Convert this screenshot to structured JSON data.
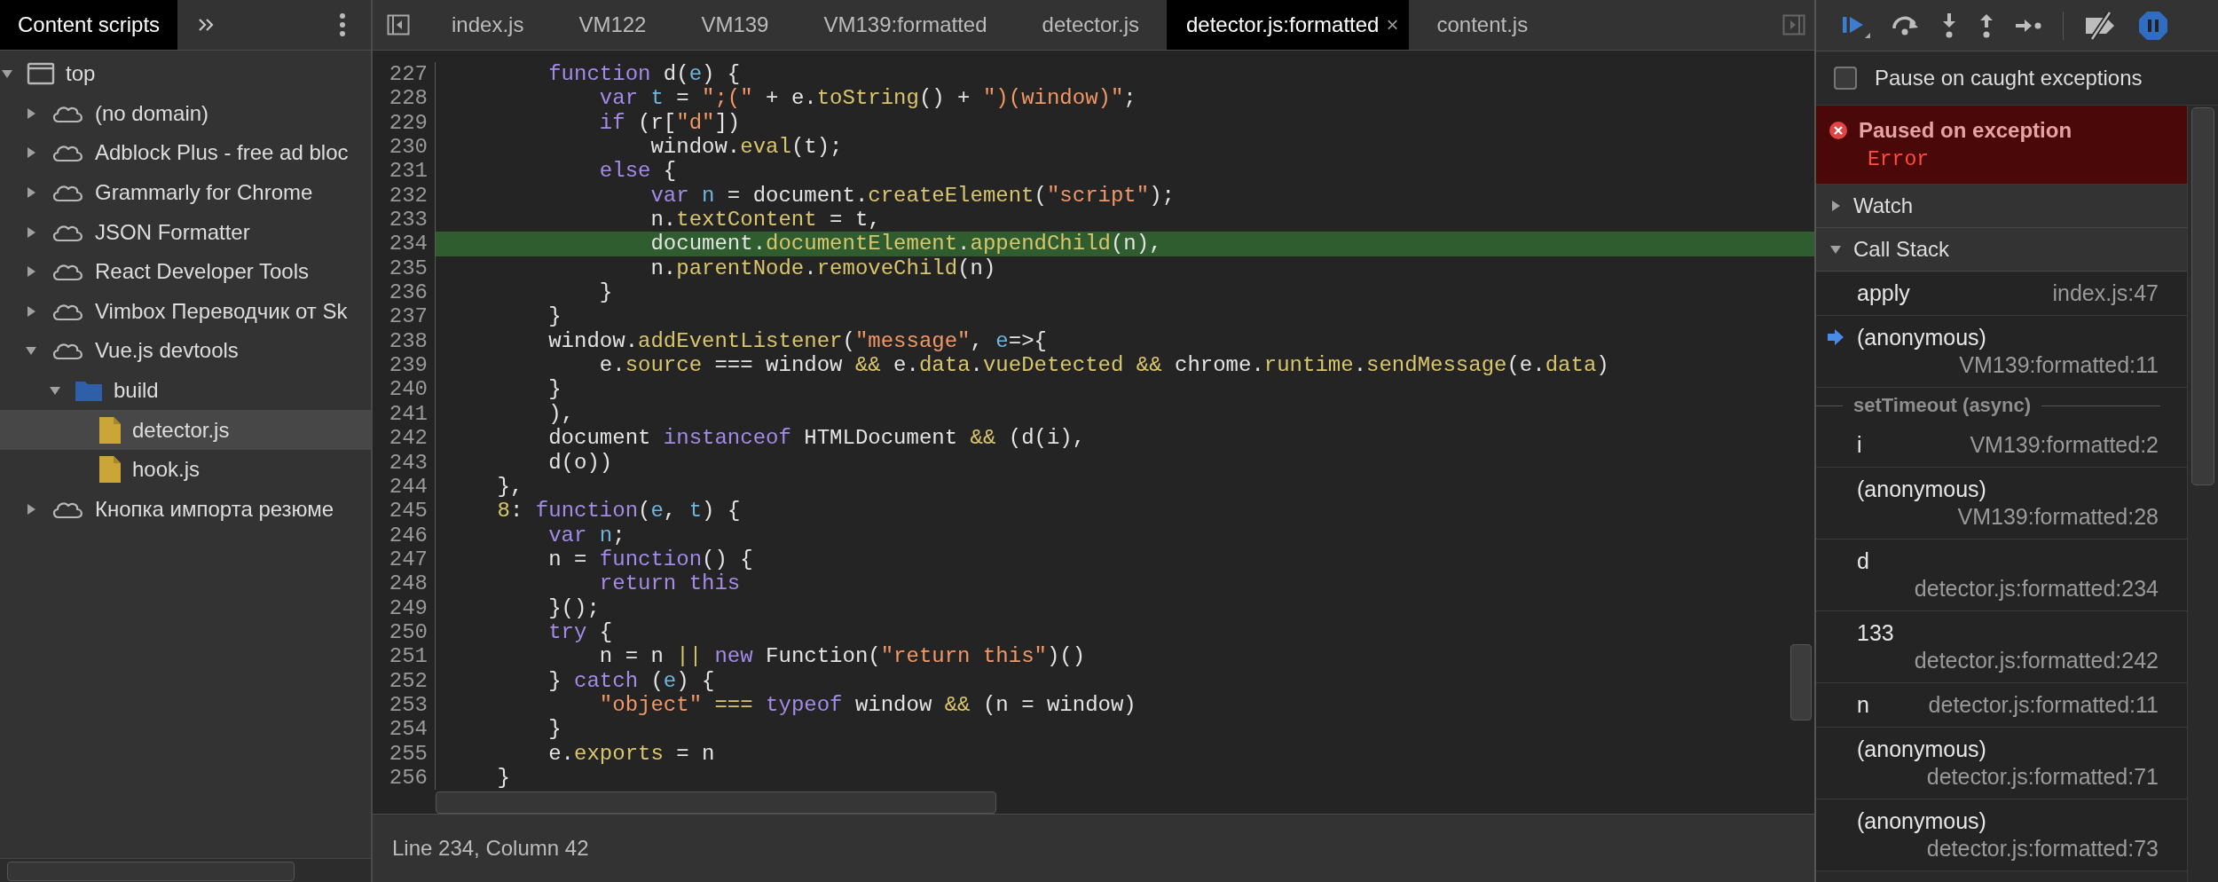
{
  "sidebar": {
    "tabs": [
      {
        "label": "Content scripts",
        "selected": true
      }
    ],
    "tree": [
      {
        "label": "top",
        "kind": "frame",
        "expanded": true,
        "selected": false,
        "children": [
          {
            "label": "(no domain)",
            "kind": "domain",
            "expanded": false,
            "selected": false
          },
          {
            "label": "Adblock Plus - free ad bloc",
            "kind": "domain",
            "expanded": false,
            "selected": false
          },
          {
            "label": "Grammarly for Chrome",
            "kind": "domain",
            "expanded": false,
            "selected": false
          },
          {
            "label": "JSON Formatter",
            "kind": "domain",
            "expanded": false,
            "selected": false
          },
          {
            "label": "React Developer Tools",
            "kind": "domain",
            "expanded": false,
            "selected": false
          },
          {
            "label": "Vimbox Переводчик от Sk",
            "kind": "domain",
            "expanded": false,
            "selected": false
          },
          {
            "label": "Vue.js devtools",
            "kind": "domain",
            "expanded": true,
            "selected": false,
            "children": [
              {
                "label": "build",
                "kind": "folder",
                "expanded": true,
                "selected": false,
                "children": [
                  {
                    "label": "detector.js",
                    "kind": "file",
                    "selected": true
                  },
                  {
                    "label": "hook.js",
                    "kind": "file",
                    "selected": false
                  }
                ]
              }
            ]
          },
          {
            "label": "Кнопка импорта резюме",
            "kind": "domain",
            "expanded": false,
            "selected": false
          }
        ]
      }
    ]
  },
  "editor": {
    "tabs": [
      {
        "label": "index.js",
        "selected": false
      },
      {
        "label": "VM122",
        "selected": false
      },
      {
        "label": "VM139",
        "selected": false
      },
      {
        "label": "VM139:formatted",
        "selected": false
      },
      {
        "label": "detector.js",
        "selected": false
      },
      {
        "label": "detector.js:formatted",
        "selected": true,
        "close": "×"
      },
      {
        "label": "content.js",
        "selected": false
      }
    ],
    "lines": [
      {
        "number": "227",
        "current": false,
        "tokens": [
          {
            "kind": "keyword",
            "text": "        function"
          },
          {
            "kind": "plain",
            "text": " d("
          },
          {
            "kind": "param",
            "text": "e"
          },
          {
            "kind": "plain",
            "text": ") {"
          }
        ]
      },
      {
        "number": "228",
        "current": false,
        "tokens": [
          {
            "kind": "keyword",
            "text": "            var "
          },
          {
            "kind": "param",
            "text": "t"
          },
          {
            "kind": "plain",
            "text": " = "
          },
          {
            "kind": "string",
            "text": "\";(\""
          },
          {
            "kind": "plain",
            "text": " + e."
          },
          {
            "kind": "property",
            "text": "toString"
          },
          {
            "kind": "plain",
            "text": "() + "
          },
          {
            "kind": "string",
            "text": "\")(window)\""
          },
          {
            "kind": "plain",
            "text": ";"
          }
        ]
      },
      {
        "number": "229",
        "current": false,
        "tokens": [
          {
            "kind": "keyword",
            "text": "            if"
          },
          {
            "kind": "plain",
            "text": " (r["
          },
          {
            "kind": "string",
            "text": "\"d\""
          },
          {
            "kind": "plain",
            "text": "])"
          }
        ]
      },
      {
        "number": "230",
        "current": false,
        "tokens": [
          {
            "kind": "plain",
            "text": "                window."
          },
          {
            "kind": "property",
            "text": "eval"
          },
          {
            "kind": "plain",
            "text": "(t);"
          }
        ]
      },
      {
        "number": "231",
        "current": false,
        "tokens": [
          {
            "kind": "keyword",
            "text": "            else"
          },
          {
            "kind": "plain",
            "text": " {"
          }
        ]
      },
      {
        "number": "232",
        "current": false,
        "tokens": [
          {
            "kind": "keyword",
            "text": "                var "
          },
          {
            "kind": "param",
            "text": "n"
          },
          {
            "kind": "plain",
            "text": " = document."
          },
          {
            "kind": "property",
            "text": "createElement"
          },
          {
            "kind": "plain",
            "text": "("
          },
          {
            "kind": "string",
            "text": "\"script\""
          },
          {
            "kind": "plain",
            "text": ");"
          }
        ]
      },
      {
        "number": "233",
        "current": false,
        "tokens": [
          {
            "kind": "plain",
            "text": "                n."
          },
          {
            "kind": "property",
            "text": "textContent"
          },
          {
            "kind": "plain",
            "text": " = t,"
          }
        ]
      },
      {
        "number": "234",
        "current": true,
        "tokens": [
          {
            "kind": "plain",
            "text": "                document."
          },
          {
            "kind": "property",
            "text": "documentElement"
          },
          {
            "kind": "plain",
            "text": "."
          },
          {
            "kind": "property",
            "text": "appendChild"
          },
          {
            "kind": "plain",
            "text": "(n),"
          }
        ]
      },
      {
        "number": "235",
        "current": false,
        "tokens": [
          {
            "kind": "plain",
            "text": "                n."
          },
          {
            "kind": "property",
            "text": "parentNode"
          },
          {
            "kind": "plain",
            "text": "."
          },
          {
            "kind": "property",
            "text": "removeChild"
          },
          {
            "kind": "plain",
            "text": "(n)"
          }
        ]
      },
      {
        "number": "236",
        "current": false,
        "tokens": [
          {
            "kind": "plain",
            "text": "            }"
          }
        ]
      },
      {
        "number": "237",
        "current": false,
        "tokens": [
          {
            "kind": "plain",
            "text": "        }"
          }
        ]
      },
      {
        "number": "238",
        "current": false,
        "tokens": [
          {
            "kind": "plain",
            "text": "        window."
          },
          {
            "kind": "property",
            "text": "addEventListener"
          },
          {
            "kind": "plain",
            "text": "("
          },
          {
            "kind": "string",
            "text": "\"message\""
          },
          {
            "kind": "plain",
            "text": ", "
          },
          {
            "kind": "param",
            "text": "e"
          },
          {
            "kind": "plain",
            "text": "=>{"
          }
        ]
      },
      {
        "number": "239",
        "current": false,
        "tokens": [
          {
            "kind": "plain",
            "text": "            e."
          },
          {
            "kind": "property",
            "text": "source"
          },
          {
            "kind": "plain",
            "text": " === window "
          },
          {
            "kind": "operator",
            "text": "&&"
          },
          {
            "kind": "plain",
            "text": " e."
          },
          {
            "kind": "property",
            "text": "data"
          },
          {
            "kind": "plain",
            "text": "."
          },
          {
            "kind": "property",
            "text": "vueDetected "
          },
          {
            "kind": "operator",
            "text": "&&"
          },
          {
            "kind": "plain",
            "text": " chrome."
          },
          {
            "kind": "property",
            "text": "runtime"
          },
          {
            "kind": "plain",
            "text": "."
          },
          {
            "kind": "property",
            "text": "sendMessage"
          },
          {
            "kind": "plain",
            "text": "(e."
          },
          {
            "kind": "property",
            "text": "data"
          },
          {
            "kind": "plain",
            "text": ")"
          }
        ]
      },
      {
        "number": "240",
        "current": false,
        "tokens": [
          {
            "kind": "plain",
            "text": "        }"
          }
        ]
      },
      {
        "number": "241",
        "current": false,
        "tokens": [
          {
            "kind": "plain",
            "text": "        ),"
          }
        ]
      },
      {
        "number": "242",
        "current": false,
        "tokens": [
          {
            "kind": "plain",
            "text": "        document "
          },
          {
            "kind": "keyword",
            "text": "instanceof"
          },
          {
            "kind": "plain",
            "text": " HTMLDocument "
          },
          {
            "kind": "operator",
            "text": "&&"
          },
          {
            "kind": "plain",
            "text": " (d(i),"
          }
        ]
      },
      {
        "number": "243",
        "current": false,
        "tokens": [
          {
            "kind": "plain",
            "text": "        d(o))"
          }
        ]
      },
      {
        "number": "244",
        "current": false,
        "tokens": [
          {
            "kind": "plain",
            "text": "    },"
          }
        ]
      },
      {
        "number": "245",
        "current": false,
        "tokens": [
          {
            "kind": "number",
            "text": "    8"
          },
          {
            "kind": "plain",
            "text": ": "
          },
          {
            "kind": "keyword",
            "text": "function"
          },
          {
            "kind": "plain",
            "text": "("
          },
          {
            "kind": "param",
            "text": "e"
          },
          {
            "kind": "plain",
            "text": ", "
          },
          {
            "kind": "param",
            "text": "t"
          },
          {
            "kind": "plain",
            "text": ") {"
          }
        ]
      },
      {
        "number": "246",
        "current": false,
        "tokens": [
          {
            "kind": "keyword",
            "text": "        var "
          },
          {
            "kind": "param",
            "text": "n"
          },
          {
            "kind": "plain",
            "text": ";"
          }
        ]
      },
      {
        "number": "247",
        "current": false,
        "tokens": [
          {
            "kind": "plain",
            "text": "        n = "
          },
          {
            "kind": "keyword",
            "text": "function"
          },
          {
            "kind": "plain",
            "text": "() {"
          }
        ]
      },
      {
        "number": "248",
        "current": false,
        "tokens": [
          {
            "kind": "keyword",
            "text": "            return this"
          }
        ]
      },
      {
        "number": "249",
        "current": false,
        "tokens": [
          {
            "kind": "plain",
            "text": "        }();"
          }
        ]
      },
      {
        "number": "250",
        "current": false,
        "tokens": [
          {
            "kind": "keyword",
            "text": "        try"
          },
          {
            "kind": "plain",
            "text": " {"
          }
        ]
      },
      {
        "number": "251",
        "current": false,
        "tokens": [
          {
            "kind": "plain",
            "text": "            n = n "
          },
          {
            "kind": "operator",
            "text": "||"
          },
          {
            "kind": "keyword",
            "text": " new"
          },
          {
            "kind": "plain",
            "text": " Function("
          },
          {
            "kind": "string",
            "text": "\"return this\""
          },
          {
            "kind": "plain",
            "text": ")()"
          }
        ]
      },
      {
        "number": "252",
        "current": false,
        "tokens": [
          {
            "kind": "plain",
            "text": "        } "
          },
          {
            "kind": "keyword",
            "text": "catch"
          },
          {
            "kind": "plain",
            "text": " ("
          },
          {
            "kind": "param",
            "text": "e"
          },
          {
            "kind": "plain",
            "text": ") {"
          }
        ]
      },
      {
        "number": "253",
        "current": false,
        "tokens": [
          {
            "kind": "string",
            "text": "            \"object\" "
          },
          {
            "kind": "operator",
            "text": "==="
          },
          {
            "kind": "keyword",
            "text": " typeof"
          },
          {
            "kind": "plain",
            "text": " window "
          },
          {
            "kind": "operator",
            "text": "&&"
          },
          {
            "kind": "plain",
            "text": " (n = window)"
          }
        ]
      },
      {
        "number": "254",
        "current": false,
        "tokens": [
          {
            "kind": "plain",
            "text": "        }"
          }
        ]
      },
      {
        "number": "255",
        "current": false,
        "tokens": [
          {
            "kind": "plain",
            "text": "        e."
          },
          {
            "kind": "property",
            "text": "exports"
          },
          {
            "kind": "plain",
            "text": " = n"
          }
        ]
      },
      {
        "number": "256",
        "current": false,
        "tokens": [
          {
            "kind": "plain",
            "text": "    }"
          }
        ]
      }
    ]
  },
  "status_bar": "Line 234, Column 42",
  "debugger": {
    "pause_on_caught": {
      "label": "Pause on caught exceptions",
      "checked": false
    },
    "banner": {
      "title": "Paused on exception",
      "message": "Error"
    },
    "sections": [
      {
        "label": "Watch",
        "expanded": false
      },
      {
        "label": "Call Stack",
        "expanded": true
      }
    ],
    "call_stack": [
      {
        "kind": "frame",
        "name": "apply",
        "location": "index.js:47",
        "current": false
      },
      {
        "kind": "frame",
        "name": "(anonymous)",
        "location": "VM139:formatted:11",
        "current": true
      },
      {
        "kind": "async",
        "label": "setTimeout (async)"
      },
      {
        "kind": "frame",
        "name": "i",
        "location": "VM139:formatted:2",
        "current": false
      },
      {
        "kind": "frame",
        "name": "(anonymous)",
        "location": "VM139:formatted:28",
        "current": false
      },
      {
        "kind": "frame",
        "name": "d",
        "location": "detector.js:formatted:234",
        "current": false
      },
      {
        "kind": "frame",
        "name": "133",
        "location": "detector.js:formatted:242",
        "current": false
      },
      {
        "kind": "frame",
        "name": "n",
        "location": "detector.js:formatted:11",
        "current": false
      },
      {
        "kind": "frame",
        "name": "(anonymous)",
        "location": "detector.js:formatted:71",
        "current": false
      },
      {
        "kind": "frame",
        "name": "(anonymous)",
        "location": "detector.js:formatted:73",
        "current": false
      }
    ]
  }
}
